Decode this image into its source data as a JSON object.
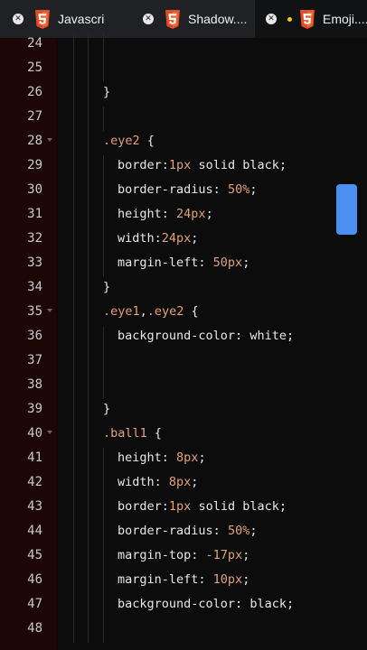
{
  "tabs": [
    {
      "label": "Javascri",
      "active": false,
      "dirty": false
    },
    {
      "label": "Shadow....",
      "active": false,
      "dirty": false
    },
    {
      "label": "Emoji....",
      "active": true,
      "dirty": true
    }
  ],
  "icons": {
    "close": "close-icon",
    "file": "html5-icon",
    "fold": "fold-arrow-icon"
  },
  "colors": {
    "tab_bar": "#202124",
    "gutter": "#1c0606",
    "editor_bg": "#0c0c0c",
    "selector": "#e2a27a",
    "number": "#e2a27a",
    "property": "#e8e8e8",
    "scroll_thumb": "#4a90f0",
    "dirty_dot": "#f5c518"
  },
  "editor": {
    "lines": [
      {
        "num": "24",
        "fold": false,
        "tokens": []
      },
      {
        "num": "25",
        "fold": false,
        "tokens": []
      },
      {
        "num": "26",
        "fold": false,
        "tokens": [
          {
            "t": "}",
            "k": "pun"
          }
        ]
      },
      {
        "num": "27",
        "fold": false,
        "tokens": []
      },
      {
        "num": "28",
        "fold": true,
        "tokens": [
          {
            "t": ".eye2",
            "k": "sel"
          },
          {
            "t": " {",
            "k": "pun"
          }
        ]
      },
      {
        "num": "29",
        "fold": false,
        "tokens": [
          {
            "t": "border",
            "k": "prop"
          },
          {
            "t": ":",
            "k": "pun"
          },
          {
            "t": "1px",
            "k": "num"
          },
          {
            "t": " solid black",
            "k": "val"
          },
          {
            "t": ";",
            "k": "pun"
          }
        ]
      },
      {
        "num": "30",
        "fold": false,
        "tokens": [
          {
            "t": "border-radius",
            "k": "prop"
          },
          {
            "t": ": ",
            "k": "pun"
          },
          {
            "t": "50%",
            "k": "num"
          },
          {
            "t": ";",
            "k": "pun"
          }
        ]
      },
      {
        "num": "31",
        "fold": false,
        "tokens": [
          {
            "t": "height",
            "k": "prop"
          },
          {
            "t": ": ",
            "k": "pun"
          },
          {
            "t": "24px",
            "k": "num"
          },
          {
            "t": ";",
            "k": "pun"
          }
        ]
      },
      {
        "num": "32",
        "fold": false,
        "tokens": [
          {
            "t": "width",
            "k": "prop"
          },
          {
            "t": ":",
            "k": "pun"
          },
          {
            "t": "24px",
            "k": "num"
          },
          {
            "t": ";",
            "k": "pun"
          }
        ]
      },
      {
        "num": "33",
        "fold": false,
        "tokens": [
          {
            "t": "margin-left",
            "k": "prop"
          },
          {
            "t": ": ",
            "k": "pun"
          },
          {
            "t": "50px",
            "k": "num"
          },
          {
            "t": ";",
            "k": "pun"
          }
        ]
      },
      {
        "num": "34",
        "fold": false,
        "tokens": [
          {
            "t": "}",
            "k": "pun"
          }
        ]
      },
      {
        "num": "35",
        "fold": true,
        "tokens": [
          {
            "t": ".eye1",
            "k": "sel"
          },
          {
            "t": ",",
            "k": "pun"
          },
          {
            "t": ".eye2",
            "k": "sel"
          },
          {
            "t": " {",
            "k": "pun"
          }
        ]
      },
      {
        "num": "36",
        "fold": false,
        "tokens": [
          {
            "t": "background-color",
            "k": "prop"
          },
          {
            "t": ": ",
            "k": "pun"
          },
          {
            "t": "white",
            "k": "val"
          },
          {
            "t": ";",
            "k": "pun"
          }
        ]
      },
      {
        "num": "37",
        "fold": false,
        "tokens": []
      },
      {
        "num": "38",
        "fold": false,
        "tokens": []
      },
      {
        "num": "39",
        "fold": false,
        "tokens": [
          {
            "t": "}",
            "k": "pun"
          }
        ]
      },
      {
        "num": "40",
        "fold": true,
        "tokens": [
          {
            "t": ".ball1",
            "k": "sel"
          },
          {
            "t": " {",
            "k": "pun"
          }
        ]
      },
      {
        "num": "41",
        "fold": false,
        "tokens": [
          {
            "t": "height",
            "k": "prop"
          },
          {
            "t": ": ",
            "k": "pun"
          },
          {
            "t": "8px",
            "k": "num"
          },
          {
            "t": ";",
            "k": "pun"
          }
        ]
      },
      {
        "num": "42",
        "fold": false,
        "tokens": [
          {
            "t": "width",
            "k": "prop"
          },
          {
            "t": ": ",
            "k": "pun"
          },
          {
            "t": "8px",
            "k": "num"
          },
          {
            "t": ";",
            "k": "pun"
          }
        ]
      },
      {
        "num": "43",
        "fold": false,
        "tokens": [
          {
            "t": "border",
            "k": "prop"
          },
          {
            "t": ":",
            "k": "pun"
          },
          {
            "t": "1px",
            "k": "num"
          },
          {
            "t": " solid black",
            "k": "val"
          },
          {
            "t": ";",
            "k": "pun"
          }
        ]
      },
      {
        "num": "44",
        "fold": false,
        "tokens": [
          {
            "t": "border-radius",
            "k": "prop"
          },
          {
            "t": ": ",
            "k": "pun"
          },
          {
            "t": "50%",
            "k": "num"
          },
          {
            "t": ";",
            "k": "pun"
          }
        ]
      },
      {
        "num": "45",
        "fold": false,
        "tokens": [
          {
            "t": "margin-top",
            "k": "prop"
          },
          {
            "t": ": ",
            "k": "pun"
          },
          {
            "t": "-17px",
            "k": "num"
          },
          {
            "t": ";",
            "k": "pun"
          }
        ]
      },
      {
        "num": "46",
        "fold": false,
        "tokens": [
          {
            "t": "margin-left",
            "k": "prop"
          },
          {
            "t": ": ",
            "k": "pun"
          },
          {
            "t": "10px",
            "k": "num"
          },
          {
            "t": ";",
            "k": "pun"
          }
        ]
      },
      {
        "num": "47",
        "fold": false,
        "tokens": [
          {
            "t": "background-color",
            "k": "prop"
          },
          {
            "t": ": ",
            "k": "pun"
          },
          {
            "t": "black",
            "k": "val"
          },
          {
            "t": ";",
            "k": "pun"
          }
        ]
      },
      {
        "num": "48",
        "fold": false,
        "tokens": []
      }
    ]
  }
}
